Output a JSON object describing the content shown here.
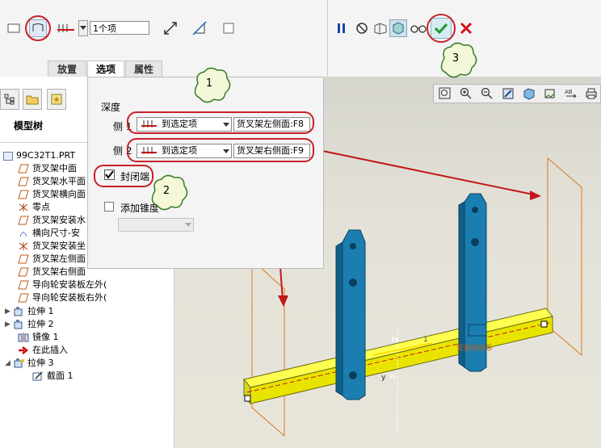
{
  "dashboard": {
    "ref_count": "1个项",
    "tabs": [
      {
        "label": "放置"
      },
      {
        "label": "选项"
      },
      {
        "label": "属性"
      }
    ]
  },
  "left_panel": {
    "title": "模型树",
    "tree": [
      {
        "label": "99C32T1.PRT"
      },
      {
        "label": "货叉架中面"
      },
      {
        "label": "货叉架水平面"
      },
      {
        "label": "货叉架横向面"
      },
      {
        "label": "零点"
      },
      {
        "label": "货叉架安装水"
      },
      {
        "label": "横向尺寸-安"
      },
      {
        "label": "货叉架安装坐"
      },
      {
        "label": "货叉架左侧面"
      },
      {
        "label": "货叉架右侧面"
      },
      {
        "label": "导向轮安装板左外("
      },
      {
        "label": "导向轮安装板右外("
      },
      {
        "label": "拉伸 1"
      },
      {
        "label": "拉伸 2"
      },
      {
        "label": "镜像 1"
      },
      {
        "label": "在此插入"
      },
      {
        "label": "拉伸 3"
      },
      {
        "label": "截面 1"
      }
    ]
  },
  "options": {
    "depth_label": "深度",
    "side1_label": "侧 1",
    "side2_label": "侧 2",
    "side1_type": "到选定项",
    "side2_type": "到选定项",
    "side1_ref": "货叉架左侧面:F8",
    "side2_ref": "货叉架右侧面:F9",
    "capped_label": "封闭端",
    "taper_label": "添加锥度"
  },
  "callouts": [
    {
      "label": "1"
    },
    {
      "label": "2"
    },
    {
      "label": "3"
    }
  ],
  "viewport": {
    "annotation": "安装坐标系",
    "dim_label": "1",
    "label_h": "H",
    "label_y": "y"
  },
  "colors": {
    "callout_ring": "#c8202a",
    "part_blue": "#1a7fb0",
    "beam_yellow": "#e8e400",
    "accept_green": "#1a9a2a",
    "cancel_red": "#d0121b"
  }
}
